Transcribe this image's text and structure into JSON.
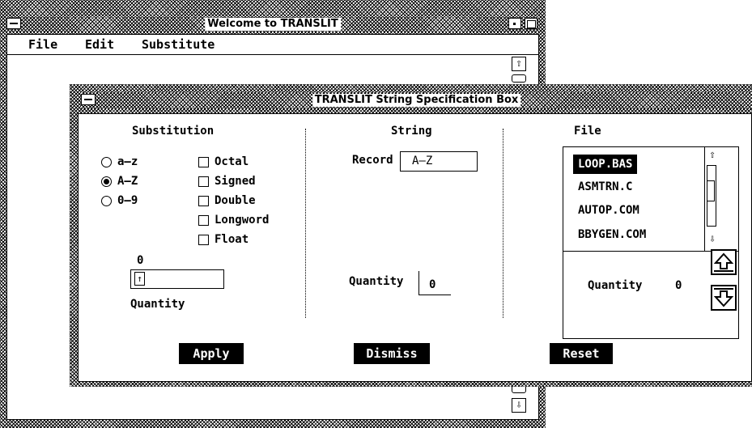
{
  "main_window": {
    "title": "Welcome to TRANSLIT",
    "menu": [
      "File",
      "Edit",
      "Substitute"
    ],
    "scroll_up": "⇧",
    "scroll_down": "⇩"
  },
  "dialog": {
    "title": "TRANSLIT String Specification Box",
    "substitution": {
      "heading": "Substitution",
      "radios": [
        {
          "label": "a–z",
          "selected": false
        },
        {
          "label": "A–Z",
          "selected": true
        },
        {
          "label": "0–9",
          "selected": false
        }
      ],
      "checkboxes": [
        {
          "label": "Octal",
          "checked": false
        },
        {
          "label": "Signed",
          "checked": false
        },
        {
          "label": "Double",
          "checked": false
        },
        {
          "label": "Longword",
          "checked": false
        },
        {
          "label": "Float",
          "checked": false
        }
      ],
      "value": "0",
      "field_glyph": "↑",
      "quantity_label": "Quantity"
    },
    "string": {
      "heading": "String",
      "record_label": "Record",
      "record_value": "A–Z",
      "quantity_label": "Quantity",
      "quantity_value": "0"
    },
    "file": {
      "heading": "File",
      "files": [
        "LOOP.BAS",
        "ASMTRN.C",
        "AUTOP.COM",
        "BBYGEN.COM"
      ],
      "selected_index": 0,
      "quantity_label": "Quantity",
      "quantity_value": "0",
      "scroll_up": "⇧",
      "scroll_down": "⇩"
    },
    "buttons": {
      "apply": "Apply",
      "dismiss": "Dismiss",
      "reset": "Reset"
    }
  }
}
